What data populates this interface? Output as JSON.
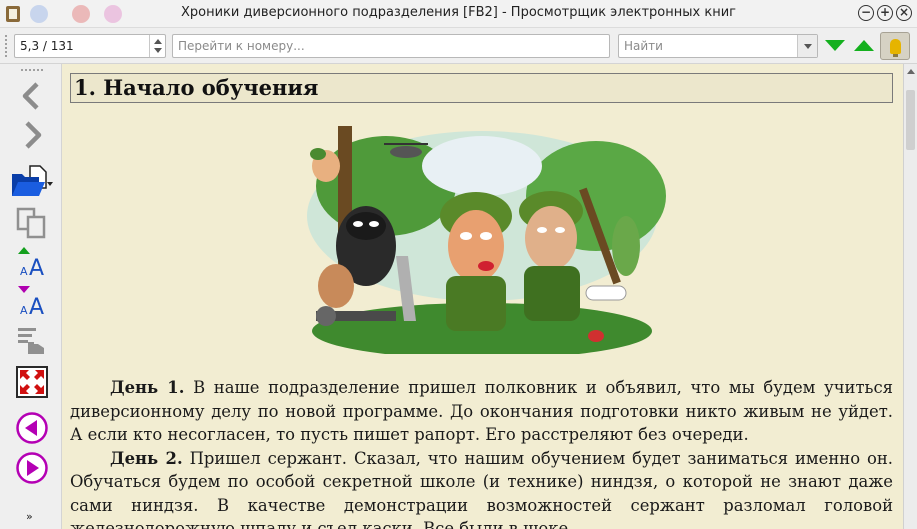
{
  "window": {
    "title": "Хроники диверсионного подразделения [FB2] - Просмотрщик электронных книг"
  },
  "toolbar": {
    "page_value": "5,3 / 131",
    "goto_placeholder": "Перейти к номеру...",
    "find_placeholder": "Найти"
  },
  "left_toolbar": {
    "icons": [
      "back-arrow-icon",
      "forward-arrow-icon",
      "open-folder-icon",
      "copy-icon",
      "increase-font-icon",
      "decrease-font-icon",
      "text-select-icon",
      "fullscreen-icon",
      "previous-page-icon",
      "next-page-icon"
    ],
    "more_label": "»"
  },
  "book": {
    "chapter_title": "1. Начало обучения",
    "paragraphs": [
      {
        "lead": "День 1.",
        "text": " В наше подразделение пришел полковник и объявил, что мы будем учиться диверсионному делу по новой программе. До окончания подготовки никто живым не уйдет. А если кто несогласен, то пусть пишет рапорт. Его расстреляют без очереди."
      },
      {
        "lead": "День 2.",
        "text": " Пришел сержант. Сказал, что нашим обучением будет заниматься именно он. Обучаться будем по особой секретной школе (и технике) ниндзя, о которой не знают даже сами ниндзя. В качестве демонстрации возможностей сержант разломал головой железнодорожную шпалу и съел каски. Все были в шоке."
      }
    ]
  },
  "colors": {
    "reader_bg": "#f2edd2",
    "find_arrows": "#14b01e",
    "page_nav": "#b400b4"
  }
}
